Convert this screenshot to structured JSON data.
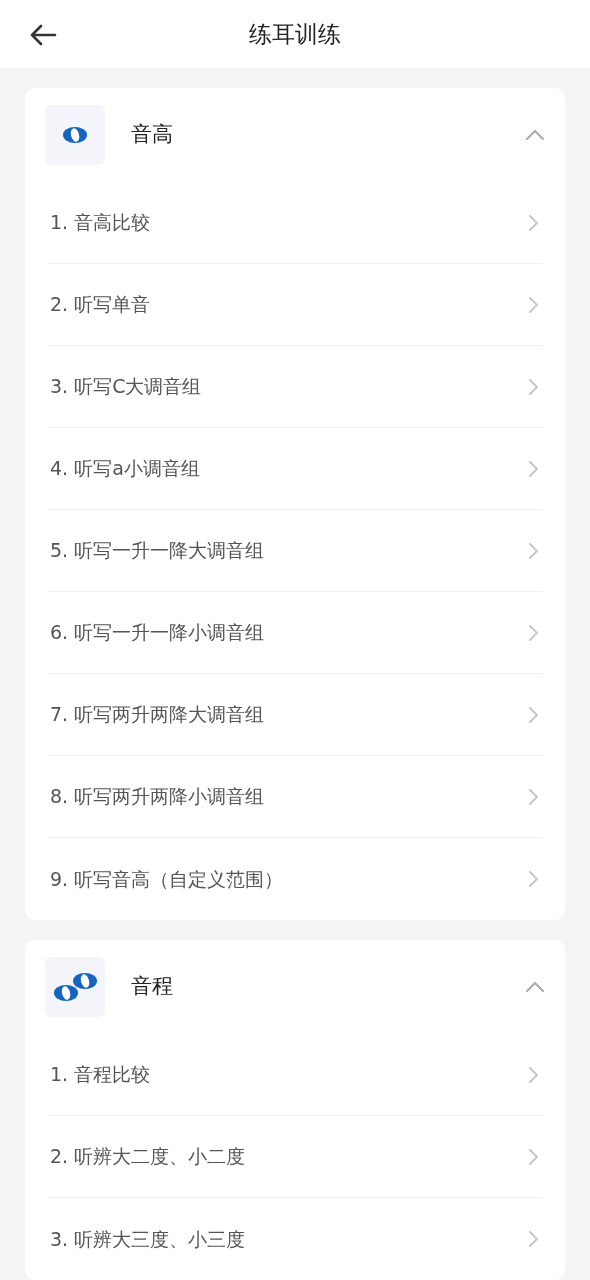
{
  "header": {
    "title": "练耳训练"
  },
  "sections": [
    {
      "title": "音高",
      "kind": "single",
      "expanded": true,
      "items": [
        "1. 音高比较",
        "2. 听写单音",
        "3. 听写C大调音组",
        "4. 听写a小调音组",
        "5. 听写一升一降大调音组",
        "6. 听写一升一降小调音组",
        "7. 听写两升两降大调音组",
        "8. 听写两升两降小调音组",
        "9. 听写音高（自定义范围）"
      ]
    },
    {
      "title": "音程",
      "kind": "double",
      "expanded": true,
      "items": [
        "1. 音程比较",
        "2. 听辨大二度、小二度",
        "3. 听辨大三度、小三度"
      ]
    }
  ]
}
